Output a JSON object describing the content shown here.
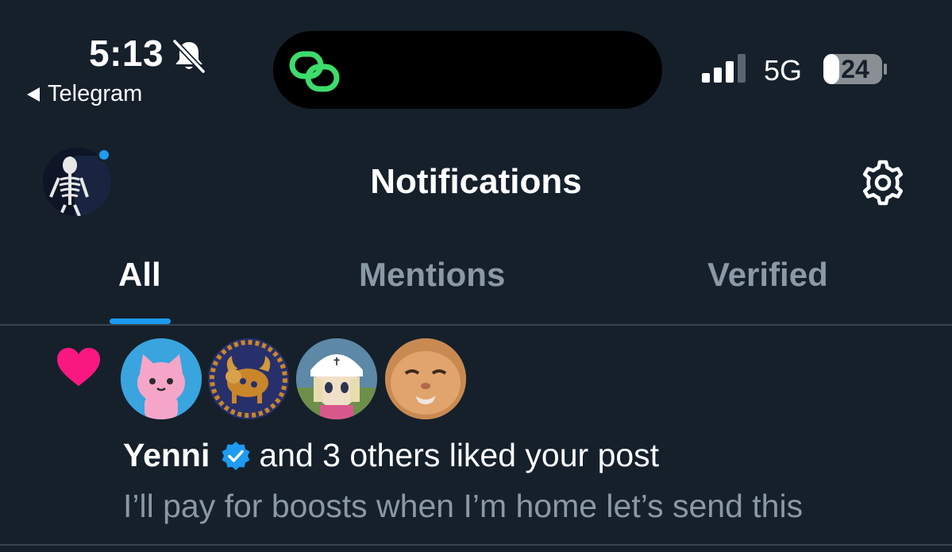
{
  "status_bar": {
    "time": "5:13",
    "back_app_label": "Telegram",
    "network": "5G",
    "battery_level": "24",
    "silent_mode": true,
    "signal_bars": 3
  },
  "header": {
    "title": "Notifications"
  },
  "tabs": [
    {
      "label": "All",
      "active": true
    },
    {
      "label": "Mentions",
      "active": false
    },
    {
      "label": "Verified",
      "active": false
    }
  ],
  "notification": {
    "type": "like",
    "user_name": "Yenni",
    "verified": true,
    "action_text": "and 3 others liked your post",
    "post_preview": "I’ll pay for boosts when I’m home let’s send this"
  },
  "colors": {
    "background": "#15202b",
    "accent": "#1d9bf0",
    "like": "#f91880",
    "muted_text": "#8b98a5",
    "island_icon": "#3ddc6b"
  }
}
